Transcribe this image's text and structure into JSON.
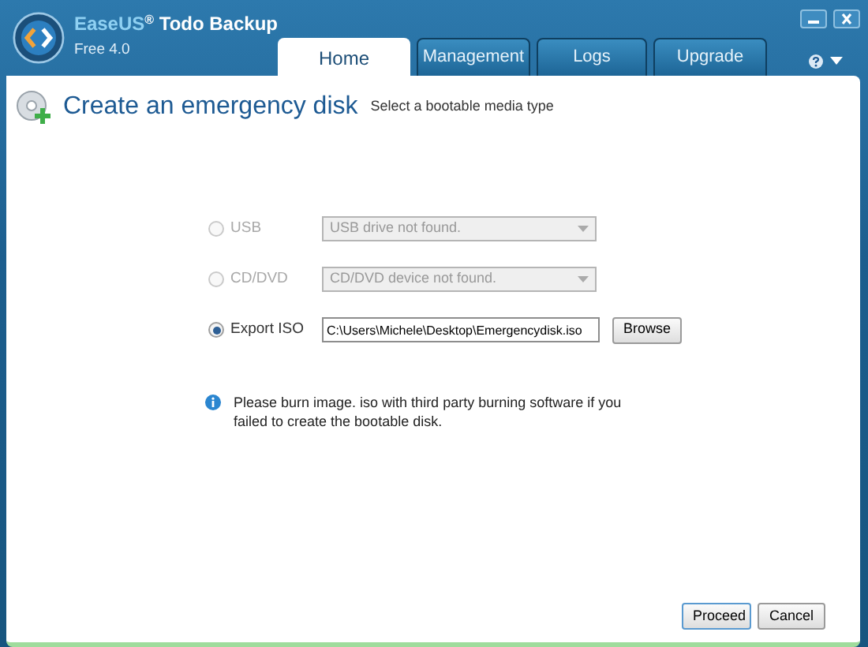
{
  "app": {
    "brand_first": "EaseUS",
    "brand_mark": "®",
    "brand_rest": "Todo Backup",
    "edition": "Free 4.0"
  },
  "tabs": [
    {
      "label": "Home",
      "selected": true
    },
    {
      "label": "Management",
      "selected": false
    },
    {
      "label": "Logs",
      "selected": false
    },
    {
      "label": "Upgrade",
      "selected": false
    }
  ],
  "page": {
    "title": "Create an emergency disk",
    "subtitle": "Select a bootable media type"
  },
  "options": [
    {
      "label": "USB",
      "selected": false,
      "disabled": true,
      "kind": "select",
      "value": "USB drive not found."
    },
    {
      "label": "CD/DVD",
      "selected": false,
      "disabled": true,
      "kind": "select",
      "value": "CD/DVD device not found."
    },
    {
      "label": "Export ISO",
      "selected": true,
      "disabled": false,
      "kind": "path",
      "value": "C:\\Users\\Michele\\Desktop\\Emergencydisk.iso",
      "button": "Browse"
    }
  ],
  "note": "Please burn image. iso with third party burning software if you failed to create the bootable disk.",
  "buttons": [
    {
      "label": "Proceed",
      "default": true
    },
    {
      "label": "Cancel",
      "default": false
    }
  ]
}
